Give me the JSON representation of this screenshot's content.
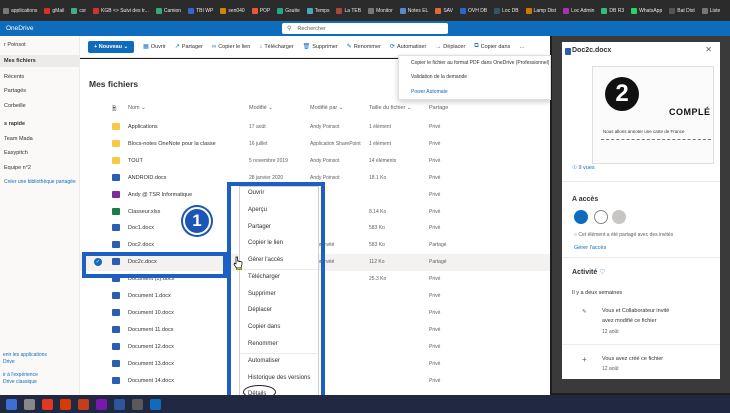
{
  "bookmarks": [
    "applications",
    "gMail",
    "csr",
    "KGB <> Suivi des tr...",
    "Camion",
    "TBI WP",
    "sen040",
    "POP",
    "Gsuite",
    "Temps",
    "La TEB",
    "Monitor",
    "Notes EL",
    "SAV",
    "OVH DB",
    "Loc DB",
    "Lamp Dist",
    "Loc Admin",
    "DB R3",
    "WhatsApp",
    "Bat Dist",
    "Liste"
  ],
  "suite": {
    "app_name": "OneDrive",
    "search_placeholder": "Rechercher"
  },
  "nav": {
    "user": "r Poinsot",
    "items": [
      "Mes fichiers",
      "Récents",
      "Partagés",
      "Corbeille"
    ],
    "shortcuts_header": "s rapide",
    "shortcuts": [
      "Team Mada",
      "Easypitch",
      "Equipe n°2"
    ],
    "create_library": "Créer une bibliothèque partagée",
    "footer": [
      "enir les applications",
      "Drive",
      "ir à l'expérience",
      "Drive classique"
    ]
  },
  "toolbar": {
    "new_label": "Nouveau",
    "commands": [
      "Ouvrir",
      "Partager",
      "Copier le lien",
      "Télécharger",
      "Supprimer",
      "Renommer",
      "Automatiser",
      "Déplacer",
      "Copier dans"
    ],
    "more": "…"
  },
  "automate_menu": [
    "Copier le fichier au format PDF dans OneDrive (Professionnel)",
    "Validation de la demande",
    "Power Automate"
  ],
  "main": {
    "title": "Mes fichiers",
    "columns": [
      "Nom",
      "Modifié",
      "Modifié par",
      "Taille du fichier",
      "Partage"
    ],
    "rows": [
      {
        "type": "folder",
        "name": "Applications",
        "modified": "17 août",
        "by": "Andy Poinsot",
        "size": "1 élément",
        "share": "Privé"
      },
      {
        "type": "folder",
        "name": "Blocs-notes OneNote pour la classe",
        "modified": "16 juillet",
        "by": "Application SharePoint",
        "size": "1 élément",
        "share": "Privé"
      },
      {
        "type": "folder",
        "name": "TOUT",
        "modified": "5 novembre 2019",
        "by": "Andy Poinsot",
        "size": "14 éléments",
        "share": "Privé"
      },
      {
        "type": "docx",
        "name": "ANDROID.docx",
        "modified": "28 janvier 2020",
        "by": "Andy Poinsot",
        "size": "18.1 Ko",
        "share": "Privé"
      },
      {
        "type": "onenote",
        "name": "Andy @ TSR Informatique",
        "modified": "",
        "by": "",
        "size": "",
        "share": "Privé"
      },
      {
        "type": "xlsx",
        "name": "Classeur.xlsx",
        "modified": "",
        "by": "",
        "size": "8.14 Ko",
        "share": "Privé"
      },
      {
        "type": "docx",
        "name": "Doc1.docx",
        "modified": "",
        "by": "",
        "size": "583 Ko",
        "share": "Privé"
      },
      {
        "type": "docx",
        "name": "Doc2.docx",
        "modified": "",
        "by": "ateur invité",
        "size": "583 Ko",
        "share": "Partagé"
      },
      {
        "type": "docx",
        "name": "Doc2c.docx",
        "modified": "",
        "by": "ateur invité",
        "size": "112 Ko",
        "share": "Partagé"
      },
      {
        "type": "docx",
        "name": "Document (1).docx",
        "modified": "",
        "by": "",
        "size": "25.3 Ko",
        "share": "Privé"
      },
      {
        "type": "docx",
        "name": "Document 1.docx",
        "modified": "",
        "by": "",
        "size": "",
        "share": "Privé"
      },
      {
        "type": "docx",
        "name": "Document 10.docx",
        "modified": "",
        "by": "",
        "size": "",
        "share": "Privé"
      },
      {
        "type": "docx",
        "name": "Document 11.docx",
        "modified": "",
        "by": "",
        "size": "",
        "share": "Privé"
      },
      {
        "type": "docx",
        "name": "Document 12.docx",
        "modified": "",
        "by": "",
        "size": "",
        "share": "Privé"
      },
      {
        "type": "docx",
        "name": "Document 13.docx",
        "modified": "",
        "by": "",
        "size": "",
        "share": "Privé"
      },
      {
        "type": "docx",
        "name": "Document 14.docx",
        "modified": "",
        "by": "",
        "size": "",
        "share": "Privé"
      }
    ]
  },
  "context_menu": [
    "Ouvrir",
    "Aperçu",
    "Partager",
    "Copier le lien",
    "Gérer l'accès",
    "Télécharger",
    "Supprimer",
    "Déplacer",
    "Copier dans",
    "Renommer",
    "Automatiser",
    "Historique des versions",
    "Détails"
  ],
  "annotation_number": "1",
  "details_pane": {
    "title": "Doc2c.docx",
    "preview_number": "2",
    "preview_heading": "COMPLÉ",
    "preview_text": "Nous allons annoter une carte de France",
    "views": "9 vues",
    "access_heading": "A accès",
    "access_text": "Cet élément a été partagé avec des invités",
    "manage_access": "Gérer l'accès",
    "activity_heading": "Activité",
    "period": "Il y a deux semaines",
    "activities": [
      {
        "text1": "Vous et Collaborateur invité",
        "text2": "avez modifié ce fichier",
        "date": "12 août"
      },
      {
        "text1": "Vous avez créé ce fichier",
        "text2": "",
        "date": "12 août"
      }
    ]
  }
}
